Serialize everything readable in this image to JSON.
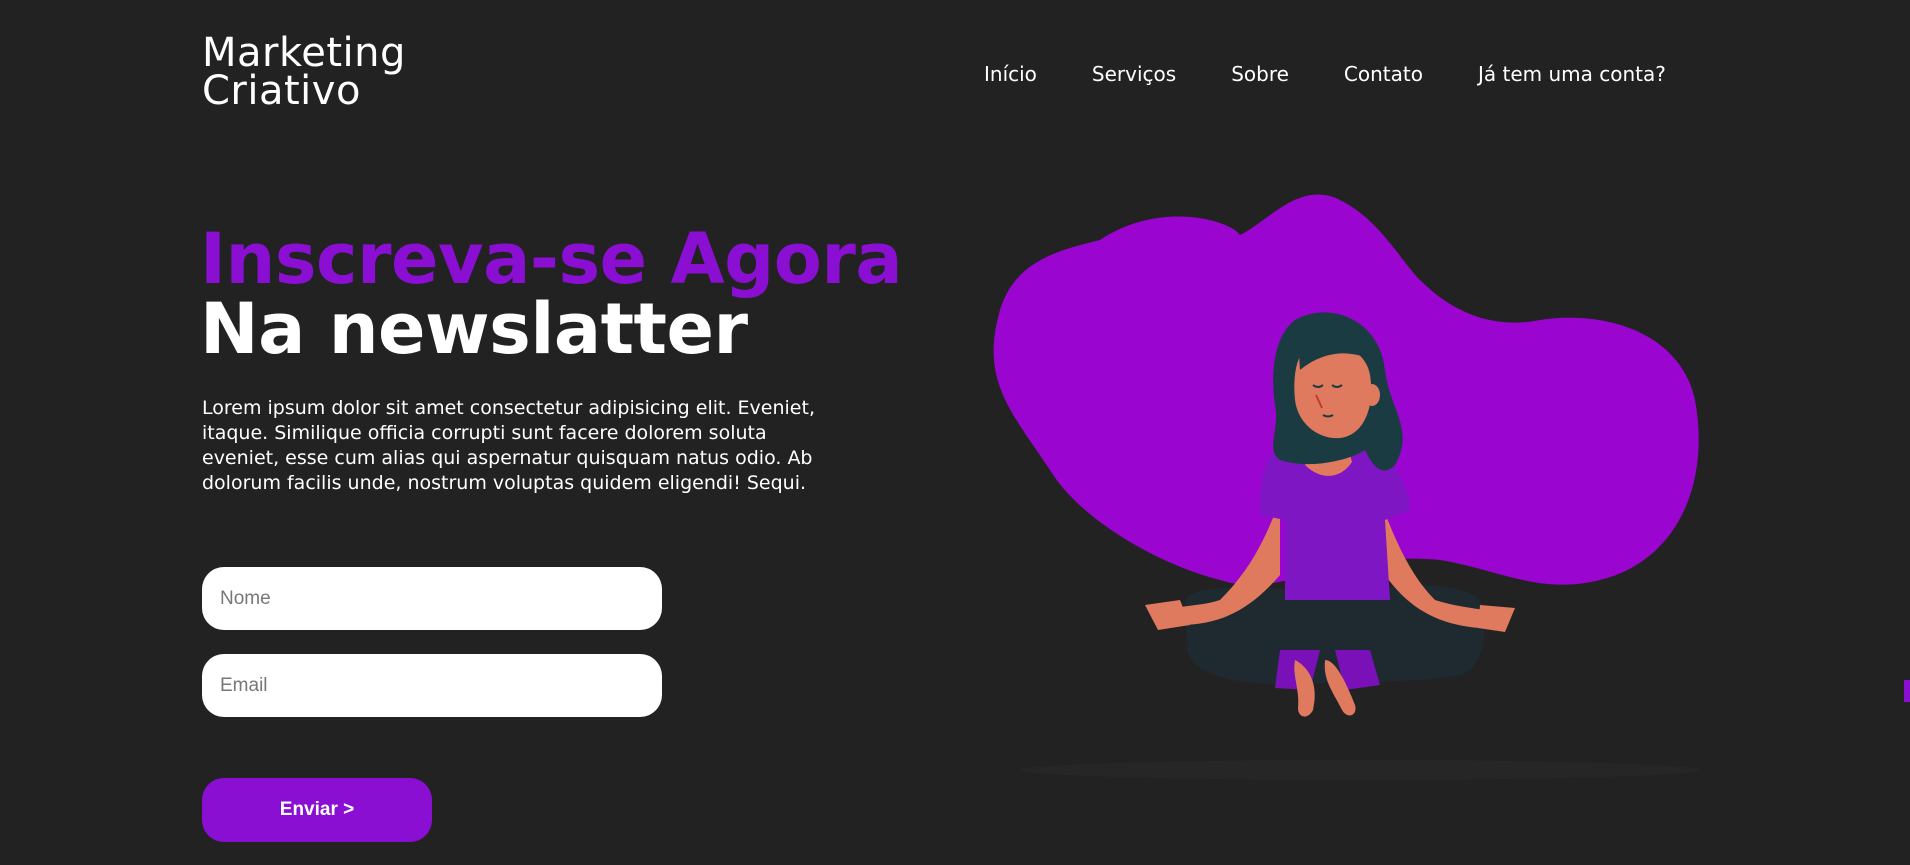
{
  "brand": {
    "line1": "Marketing",
    "line2": "Criativo"
  },
  "nav": {
    "items": [
      {
        "label": "Início"
      },
      {
        "label": "Serviços"
      },
      {
        "label": "Sobre"
      },
      {
        "label": "Contato"
      },
      {
        "label": "Já tem uma conta?"
      }
    ]
  },
  "hero": {
    "title_accent": "Inscreva-se Agora",
    "title_main": "Na newslatter",
    "description": "Lorem ipsum dolor sit amet consectetur adipisicing elit. Eveniet, itaque. Similique officia corrupti sunt facere dolorem soluta eveniet, esse cum alias qui aspernatur quisquam natus odio. Ab dolorum facilis unde, nostrum voluptas quidem eligendi! Sequi."
  },
  "form": {
    "name_placeholder": "Nome",
    "name_value": "",
    "email_placeholder": "Email",
    "email_value": "",
    "submit_label": "Enviar >"
  },
  "colors": {
    "accent": "#8a0fd3",
    "background": "#222222",
    "blob": "#9b05d0",
    "text": "#ffffff"
  },
  "illustration": {
    "icon": "meditating-woman-illustration"
  }
}
